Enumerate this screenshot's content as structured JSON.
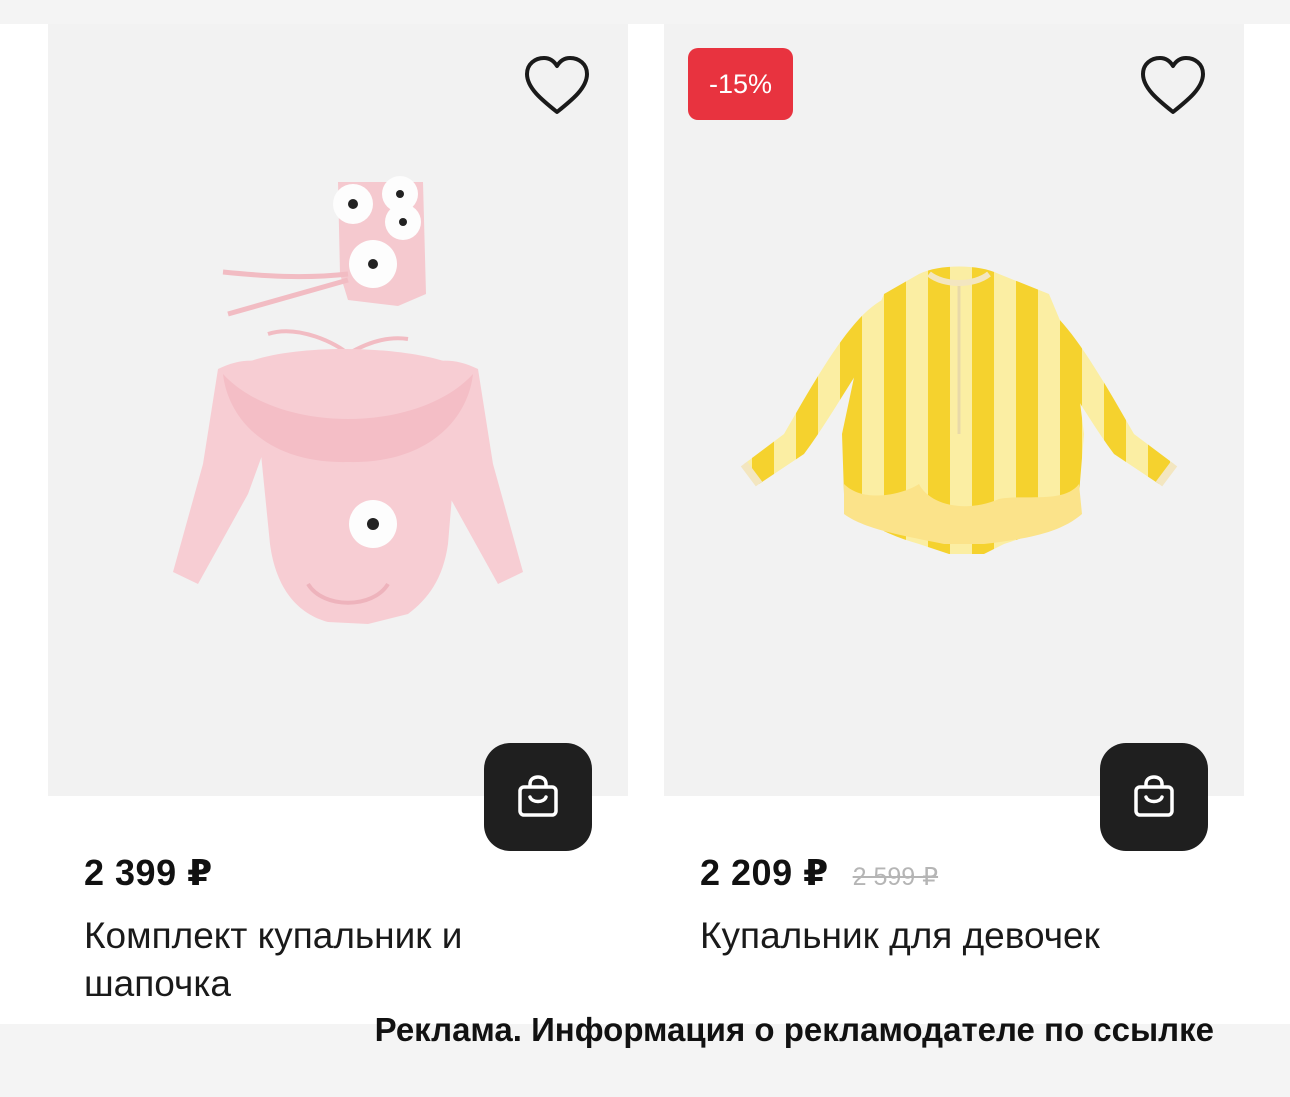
{
  "products": [
    {
      "price": "2 399 ₽",
      "title": "Комплект купальник и шапочка"
    },
    {
      "discount_badge": "-15%",
      "price": "2 209 ₽",
      "old_price": "2 599 ₽",
      "title": "Купальник для девочек"
    }
  ],
  "ad_disclaimer": "Реклама. Информация о рекламодателе по ссылке",
  "colors": {
    "badge": "#e8333f",
    "cart_button": "#1f1f1f",
    "card_image_bg": "#f2f2f2"
  },
  "icons": {
    "favorite": "heart-outline-icon",
    "cart": "shopping-bag-icon"
  }
}
